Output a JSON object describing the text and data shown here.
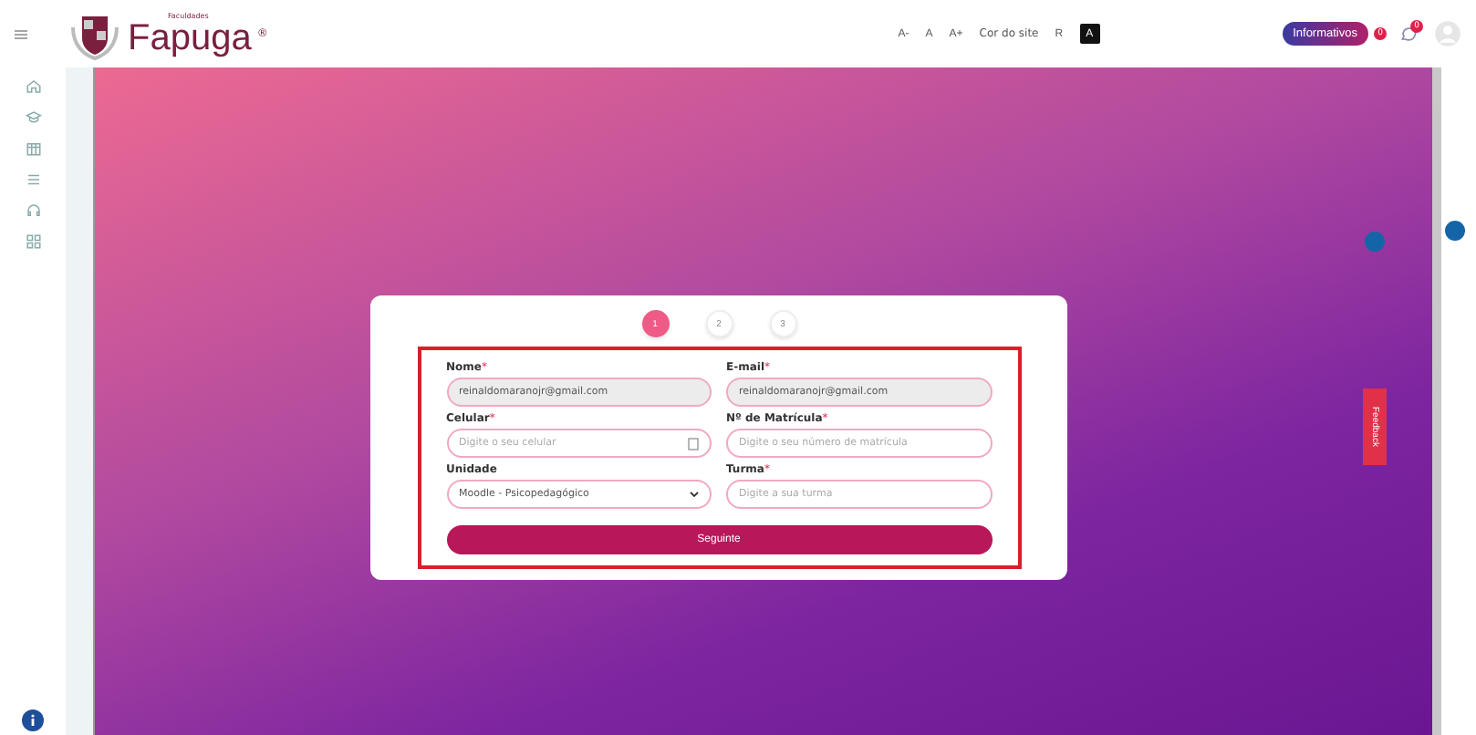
{
  "header": {
    "logo_caption": "Faculdades",
    "logo_name": "Fapuga",
    "logo_mark": "®",
    "font_controls": [
      "A-",
      "A",
      "A+"
    ],
    "site_color_label": "Cor do site",
    "site_color_option": "R",
    "contrast_button": "A",
    "informativos": "Informativos",
    "informativos_badge": "0",
    "chat_badge": "0"
  },
  "steps": [
    {
      "label": "1",
      "selected": true
    },
    {
      "label": "2",
      "selected": false
    },
    {
      "label": "3",
      "selected": false
    }
  ],
  "form": {
    "fields": [
      {
        "kind": "input",
        "label": "Nome",
        "mark": "*",
        "value": "reinaldomaranojr@gmail.com",
        "disabled": true
      },
      {
        "kind": "input",
        "label": "E-mail",
        "mark": "*",
        "value": "reinaldomaranojr@gmail.com",
        "disabled": true
      },
      {
        "kind": "phone",
        "label": "Celular",
        "mark": "*",
        "placeholder": "Digite o seu celular",
        "disabled": false
      },
      {
        "kind": "input",
        "label": "Nº de Matrícula",
        "mark": "*",
        "placeholder": "Digite o seu número de matrícula",
        "disabled": false
      },
      {
        "kind": "select",
        "label": "Unidade",
        "value": "Moodle - Psicopedagógico"
      },
      {
        "kind": "input",
        "label": "Turma",
        "mark": "*",
        "placeholder": "Digite a sua turma",
        "disabled": false
      }
    ],
    "submit": "Seguinte"
  },
  "feedback_tab": "Feedback"
}
